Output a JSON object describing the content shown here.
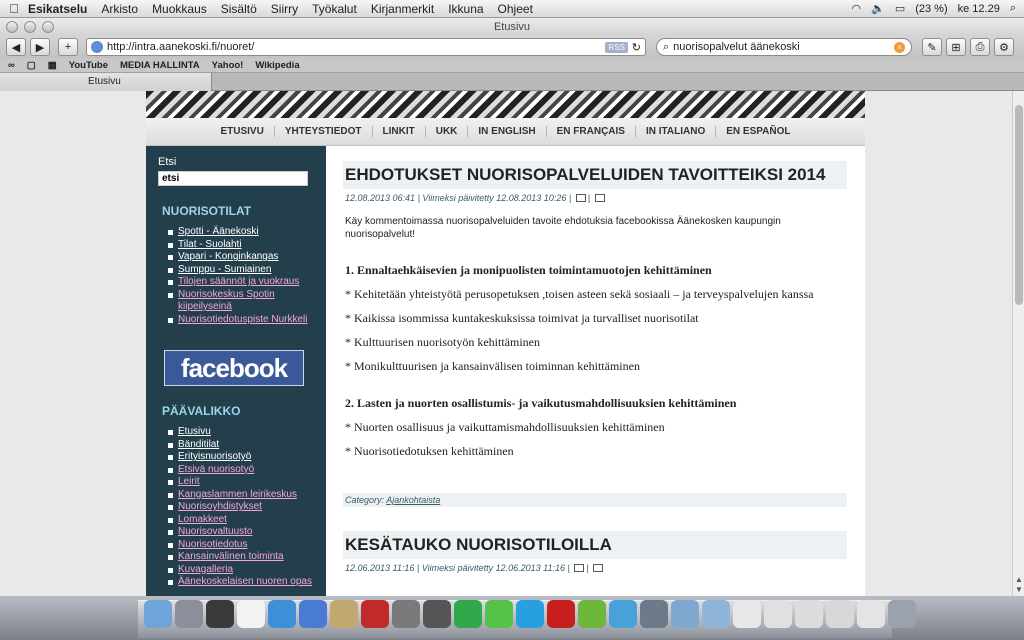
{
  "menubar": {
    "app": "Esikatselu",
    "items": [
      "Arkisto",
      "Muokkaus",
      "Sisältö",
      "Siirry",
      "Työkalut",
      "Kirjanmerkit",
      "Ikkuna",
      "Ohjeet"
    ],
    "battery": "(23 %)",
    "clock": "ke 12.29"
  },
  "window": {
    "title": "Etusivu"
  },
  "toolbar": {
    "back": "◀",
    "forward": "▶",
    "add": "+",
    "url": "http://intra.aanekoski.fi/nuoret/",
    "rss": "RSS",
    "search": "nuorisopalvelut äänekoski"
  },
  "bookmarks": [
    "YouTube",
    "MEDIA HALLINTA",
    "Yahoo!",
    "Wikipedia"
  ],
  "tab": {
    "label": "Etusivu"
  },
  "nav": [
    "ETUSIVU",
    "YHTEYSTIEDOT",
    "LINKIT",
    "UKK",
    "IN ENGLISH",
    "EN FRANÇAIS",
    "IN ITALIANO",
    "EN ESPAÑOL"
  ],
  "sidebar": {
    "search_label": "Etsi",
    "search_value": "etsi",
    "section1_title": "NUORISOTILAT",
    "section1_items": [
      {
        "label": "Spotti - Äänekoski",
        "pink": false
      },
      {
        "label": "Tilat - Suolahti",
        "pink": false
      },
      {
        "label": "Vapari - Konginkangas",
        "pink": false
      },
      {
        "label": "Sumppu - Sumiainen",
        "pink": false
      },
      {
        "label": "Tilojen säännöt ja vuokraus",
        "pink": true
      },
      {
        "label": "Nuorisokeskus Spotin kiipeilyseinä",
        "pink": true
      },
      {
        "label": "Nuorisotiedotuspiste Nurkkeli",
        "pink": true
      }
    ],
    "facebook": "facebook",
    "section2_title": "PÄÄVALIKKO",
    "section2_items": [
      {
        "label": "Etusivu",
        "pink": false
      },
      {
        "label": "Bänditilat",
        "pink": false
      },
      {
        "label": "Erityisnuorisotyö",
        "pink": false
      },
      {
        "label": "Etsivä nuorisotyö",
        "pink": true
      },
      {
        "label": "Leirit",
        "pink": true
      },
      {
        "label": "Kangaslammen leirikeskus",
        "pink": true
      },
      {
        "label": "Nuorisoyhdistykset",
        "pink": true
      },
      {
        "label": "Lomakkeet",
        "pink": true
      },
      {
        "label": "Nuorisovaltuusto",
        "pink": true
      },
      {
        "label": "Nuorisotiedotus",
        "pink": true
      },
      {
        "label": "Kansainvälinen toiminta",
        "pink": true
      },
      {
        "label": "Kuvagalleria",
        "pink": true
      },
      {
        "label": "Äänekoskelaisen nuoren opas",
        "pink": true
      }
    ]
  },
  "post1": {
    "title": "EHDOTUKSET NUORISOPALVELUIDEN TAVOITTEIKSI 2014",
    "meta": "12.08.2013 06:41 | Viimeksi päivitetty 12.08.2013 10:26 |",
    "intro": "Käy kommentoimassa nuorisopalveluiden tavoite ehdotuksia facebookissa Äänekosken kaupungin nuorisopalvelut!",
    "section1": "1. Ennaltaehkäisevien ja monipuolisten toimintamuotojen kehittäminen",
    "section1_items": [
      "* Kehitetään yhteistyötä perusopetuksen ,toisen asteen sekä sosiaali – ja terveyspalvelujen kanssa",
      "* Kaikissa isommissa kuntakeskuksissa toimivat ja turvalliset nuorisotilat",
      "* Kulttuurisen nuorisotyön kehittäminen",
      "* Monikulttuurisen ja kansainvälisen toiminnan kehittäminen"
    ],
    "section2": "2. Lasten ja nuorten osallistumis- ja vaikutusmahdollisuuksien kehittäminen",
    "section2_items": [
      "* Nuorten osallisuus ja vaikuttamismahdollisuuksien kehittäminen",
      "* Nuorisotiedotuksen kehittäminen"
    ],
    "category_label": "Category:",
    "category": "Ajankohtaista"
  },
  "post2": {
    "title": "KESÄTAUKO NUORISOTILOILLA",
    "meta": "12.06.2013 11:16 | Viimeksi päivitetty 12.06.2013 11:16 |"
  },
  "colors": {
    "sidebar": "#243f4c",
    "sidebar_heading": "#9ed3e8",
    "pink_link": "#f3a7d6",
    "facebook": "#3b5998"
  }
}
